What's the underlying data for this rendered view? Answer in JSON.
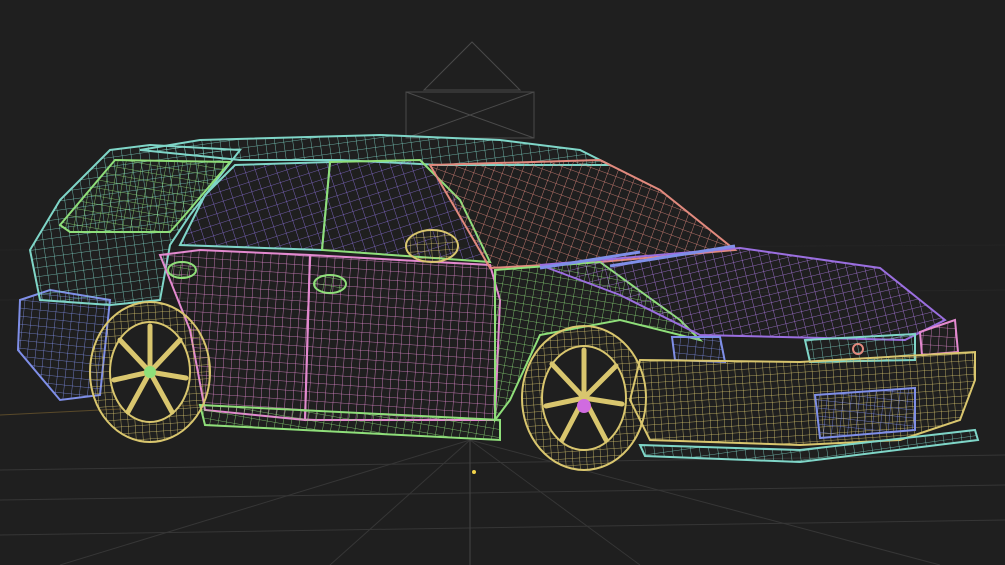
{
  "viewport": {
    "background": "#1f1f1f",
    "grid_color": "#3a3a3a",
    "object": "hatchback-car",
    "display_mode": "wireframe",
    "colors": {
      "cyan": "#7fd6c8",
      "green": "#8fdf7a",
      "pink": "#e48ad0",
      "purple": "#9b6fe0",
      "blue": "#7f8fe8",
      "yellow": "#d9c66e",
      "salmon": "#e28a7e",
      "magenta_hub": "#d06be0"
    }
  }
}
